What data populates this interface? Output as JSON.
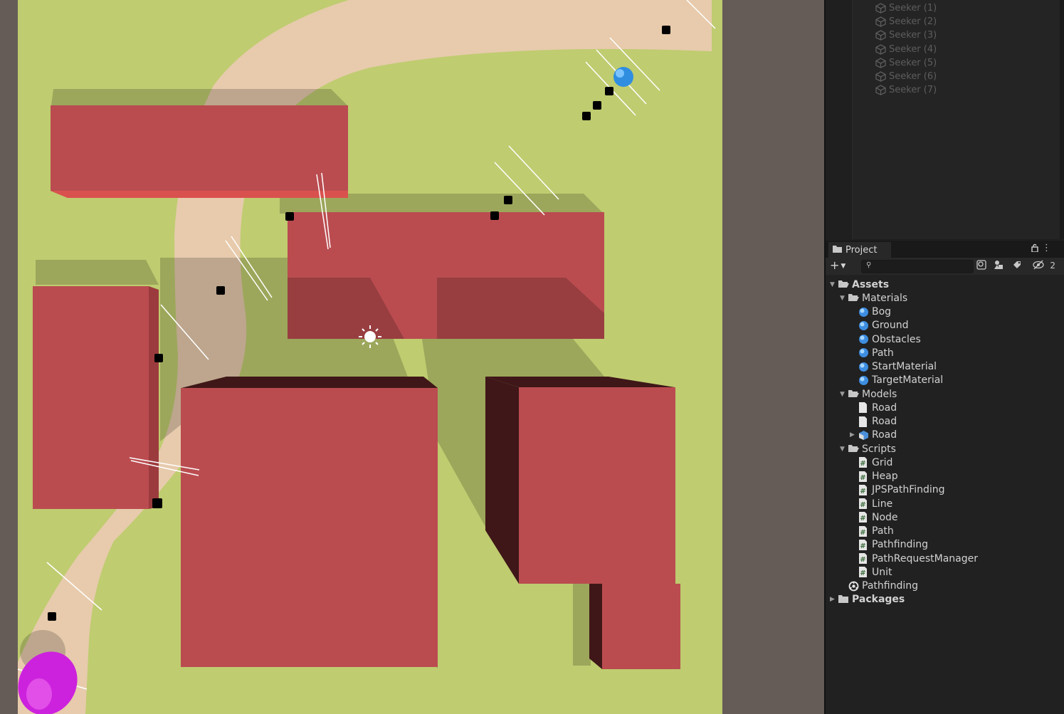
{
  "colors": {
    "ground": "#bfcc70",
    "road": "#e7cbac",
    "obstacle": "#ba4c50",
    "obstacle_dark": "#3f1718",
    "background": "#665c57",
    "seeker_start": "#2f8ee0",
    "target": "#cc22dd"
  },
  "hierarchy": {
    "items": [
      "Seeker (1)",
      "Seeker (2)",
      "Seeker (3)",
      "Seeker (4)",
      "Seeker (5)",
      "Seeker (6)",
      "Seeker (7)"
    ]
  },
  "project": {
    "tab_label": "Project",
    "add_label": "+",
    "search_placeholder": "",
    "hidden_count": "2",
    "tree": [
      {
        "label": "Assets",
        "icon": "folder-open-icon",
        "bold": true,
        "expanded": true
      },
      {
        "label": "Materials",
        "icon": "folder-open-icon",
        "expanded": true
      },
      {
        "label": "Bog",
        "icon": "material-icon"
      },
      {
        "label": "Ground",
        "icon": "material-icon"
      },
      {
        "label": "Obstacles",
        "icon": "material-icon"
      },
      {
        "label": "Path",
        "icon": "material-icon"
      },
      {
        "label": "StartMaterial",
        "icon": "material-icon"
      },
      {
        "label": "TargetMaterial",
        "icon": "material-icon"
      },
      {
        "label": "Models",
        "icon": "folder-open-icon",
        "expanded": true
      },
      {
        "label": "Road",
        "icon": "file-icon"
      },
      {
        "label": "Road",
        "icon": "file-icon"
      },
      {
        "label": "Road",
        "icon": "prefab-icon",
        "collapsed": true
      },
      {
        "label": "Scripts",
        "icon": "folder-open-icon",
        "expanded": true
      },
      {
        "label": "Grid",
        "icon": "script-icon"
      },
      {
        "label": "Heap",
        "icon": "script-icon"
      },
      {
        "label": "JPSPathFinding",
        "icon": "script-icon"
      },
      {
        "label": "Line",
        "icon": "script-icon"
      },
      {
        "label": "Node",
        "icon": "script-icon"
      },
      {
        "label": "Path",
        "icon": "script-icon"
      },
      {
        "label": "Pathfinding",
        "icon": "script-icon"
      },
      {
        "label": "PathRequestManager",
        "icon": "script-icon"
      },
      {
        "label": "Unit",
        "icon": "script-icon"
      },
      {
        "label": "Pathfinding",
        "icon": "scene-icon"
      },
      {
        "label": "Packages",
        "icon": "folder-closed-icon",
        "bold": true,
        "collapsed": true
      }
    ]
  }
}
